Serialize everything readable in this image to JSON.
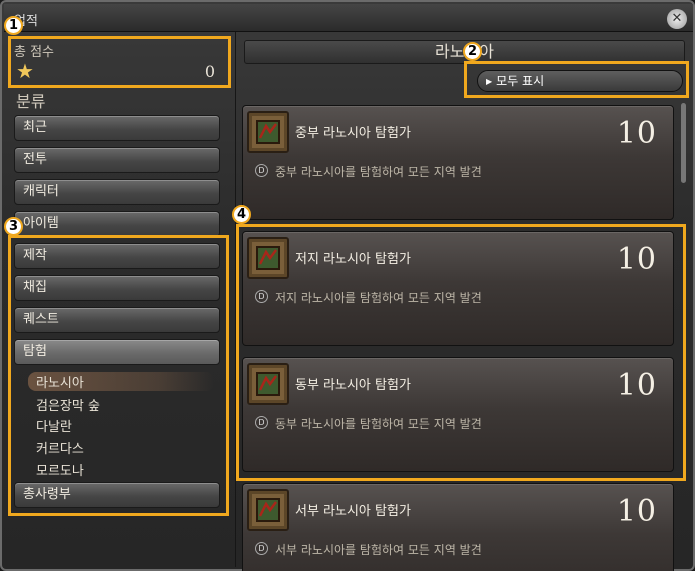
{
  "window": {
    "title": "업적",
    "close_icon": "crossed-hammers-icon"
  },
  "score": {
    "label": "총 점수",
    "value": "0",
    "icon": "star-icon"
  },
  "categories": {
    "label": "분류",
    "items": [
      {
        "label": "최근"
      },
      {
        "label": "전투"
      },
      {
        "label": "캐릭터"
      },
      {
        "label": "아이템"
      },
      {
        "label": "제작"
      },
      {
        "label": "채집"
      },
      {
        "label": "퀘스트"
      },
      {
        "label": "탐험"
      },
      {
        "label": "총사령부"
      }
    ],
    "sub_items": [
      {
        "label": "라노시아"
      },
      {
        "label": "검은장막 숲"
      },
      {
        "label": "다날란"
      },
      {
        "label": "커르다스"
      },
      {
        "label": "모르도나"
      }
    ]
  },
  "main": {
    "region": "라노시아",
    "show_all": "모두 표시",
    "achievements": [
      {
        "title": "중부 라노시아 탐험가",
        "points": "10",
        "desc": "중부 라노시아를 탐험하여 모든 지역 발견"
      },
      {
        "title": "저지 라노시아 탐험가",
        "points": "10",
        "desc": "저지 라노시아를 탐험하여 모든 지역 발견"
      },
      {
        "title": "동부 라노시아 탐험가",
        "points": "10",
        "desc": "동부 라노시아를 탐험하여 모든 지역 발견"
      },
      {
        "title": "서부 라노시아 탐험가",
        "points": "10",
        "desc": "서부 라노시아를 탐험하여 모든 지역 발견"
      }
    ]
  },
  "annotations": [
    "1",
    "2",
    "3",
    "4"
  ],
  "colors": {
    "annotation": "#f0a81e",
    "star": "#f0c75a"
  }
}
